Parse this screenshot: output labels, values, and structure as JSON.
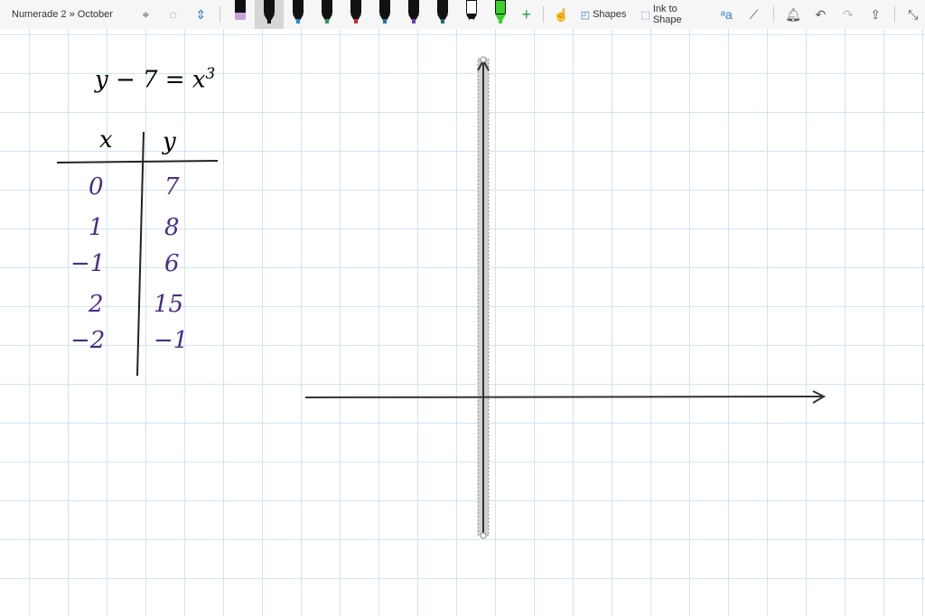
{
  "toolbar": {
    "title": "Numerade 2 » October",
    "shapes_label": "Shapes",
    "ink_to_shape_label": "Ink to Shape",
    "pens": [
      {
        "name": "eraser",
        "color": "#c9a0dc"
      },
      {
        "name": "black-pen",
        "color": "#111111",
        "selected": true
      },
      {
        "name": "blue-pen",
        "color": "#1a8fd6"
      },
      {
        "name": "green-pen",
        "color": "#1f9e5a"
      },
      {
        "name": "red-pen",
        "color": "#d12a2a"
      },
      {
        "name": "dark-blue-pen",
        "color": "#1f6fa8"
      },
      {
        "name": "purple-pen",
        "color": "#6a3fb5"
      },
      {
        "name": "teal-pen",
        "color": "#1e6e6a"
      },
      {
        "name": "white-pen",
        "color": "#ffffff"
      },
      {
        "name": "green-highlighter",
        "color": "#3ad12a"
      }
    ]
  },
  "note": {
    "equation": {
      "lhs": "y − 7 = x",
      "exp": "3"
    },
    "table": {
      "headers": [
        "x",
        "y"
      ],
      "rows": [
        [
          "0",
          "7"
        ],
        [
          "1",
          "8"
        ],
        [
          "−1",
          "6"
        ],
        [
          "2",
          "15"
        ],
        [
          "−2",
          "−1"
        ]
      ]
    }
  }
}
